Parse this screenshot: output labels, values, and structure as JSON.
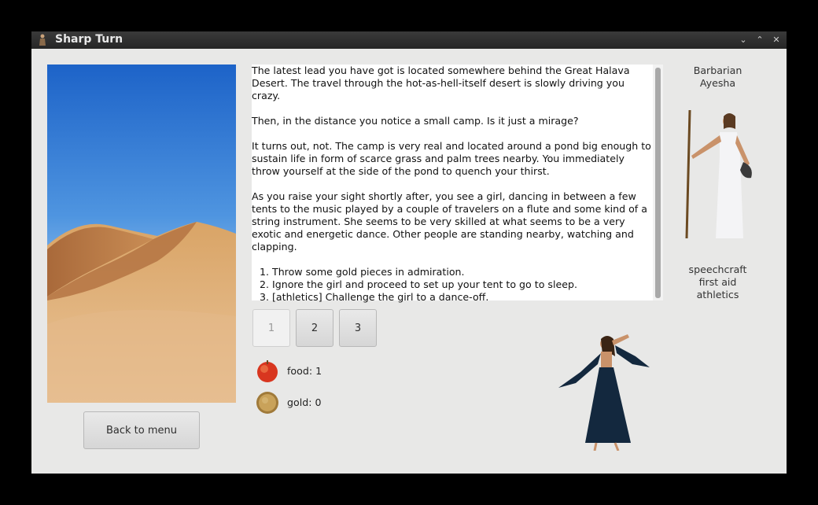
{
  "window": {
    "title": "Sharp Turn"
  },
  "left": {
    "back_label": "Back to menu"
  },
  "story": {
    "paragraphs": [
      "The latest lead you have got is located somewhere behind the Great Halava Desert. The travel through the hot-as-hell-itself desert is slowly driving you crazy.",
      "Then, in the distance you notice a small camp. Is it just a mirage?",
      "It turns out, not. The camp is very real and located around a pond big enough to sustain life in form of scarce grass and palm trees nearby. You immediately throw yourself at the side of the pond to quench your thirst.",
      "As you raise your sight shortly after, you see a girl, dancing in between a few tents to the music played by a couple of travelers on a flute and some kind of a string instrument. She seems to be very skilled at what seems to be a very exotic and energetic dance. Other people are standing nearby, watching and clapping."
    ],
    "options": [
      "Throw some gold pieces in admiration.",
      "Ignore the girl and proceed to set up your tent to go to sleep.",
      "[athletics] Challenge the girl to a dance-off."
    ]
  },
  "choices": [
    "1",
    "2",
    "3"
  ],
  "resources": {
    "food": {
      "label": "food: 1",
      "icon": "apple-icon"
    },
    "gold": {
      "label": "gold: 0",
      "icon": "gold-coin-icon"
    }
  },
  "hero": {
    "class": "Barbarian",
    "name": "Ayesha",
    "skills": [
      "speechcraft",
      "first aid",
      "athletics"
    ]
  }
}
